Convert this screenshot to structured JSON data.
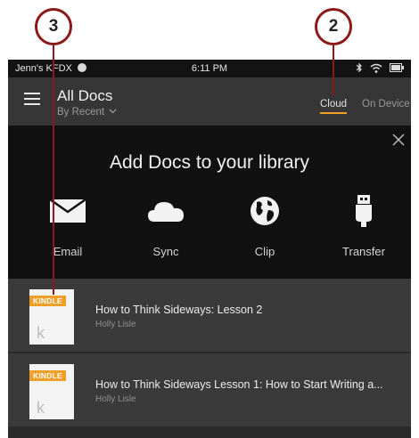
{
  "callouts": {
    "c3": "3",
    "c2": "2"
  },
  "status_bar": {
    "device_name": "Jenn's KFDX",
    "time": "6:11 PM"
  },
  "header": {
    "title": "All Docs",
    "sort": "By Recent",
    "tabs": [
      {
        "label": "Cloud",
        "active": true
      },
      {
        "label": "On Device",
        "active": false
      }
    ]
  },
  "add_panel": {
    "title": "Add Docs to your library",
    "options": [
      {
        "label": "Email",
        "icon": "envelope-icon"
      },
      {
        "label": "Sync",
        "icon": "cloud-icon"
      },
      {
        "label": "Clip",
        "icon": "globe-icon"
      },
      {
        "label": "Transfer",
        "icon": "usb-icon"
      }
    ]
  },
  "documents": [
    {
      "badge": "KINDLE",
      "cover_letter": "k",
      "title": "How to Think Sideways: Lesson 2",
      "author": "Holly Lisle"
    },
    {
      "badge": "KINDLE",
      "cover_letter": "k",
      "title": "How to Think Sideways Lesson 1: How to Start Writing a...",
      "author": "Holly Lisle"
    }
  ],
  "colors": {
    "accent": "#f0a028",
    "callout": "#8b1a1a",
    "panel": "#111111",
    "row": "#3a3a3a"
  }
}
